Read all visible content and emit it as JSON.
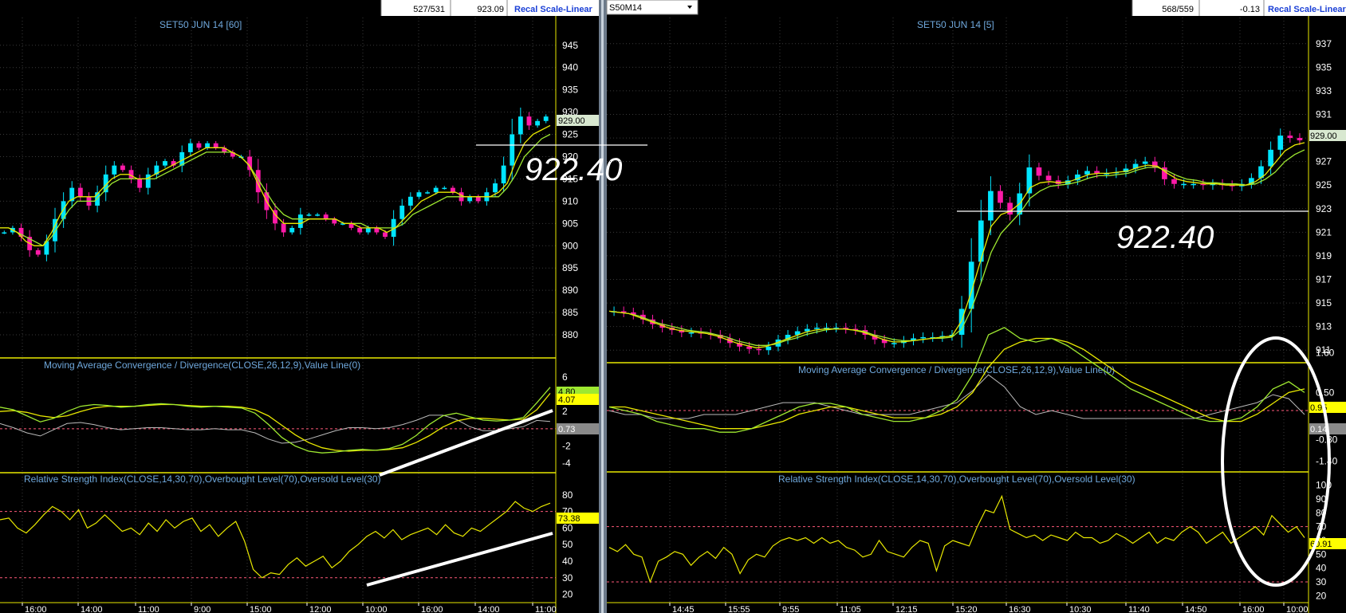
{
  "colors": {
    "background": "#000000",
    "frame": "#e8e800",
    "bull": "#00e5ff",
    "bear": "#ff1aa8",
    "ma": "#e8e800",
    "ma2": "#9ee830",
    "signal": "#bbbbbb",
    "annotation": "#ffffff",
    "grid": "#3a3a3a"
  },
  "left": {
    "header": {
      "count": "527/531",
      "price": "923.09",
      "recal": "Recal Scale-Linear"
    },
    "title": "SET50 JUN 14  [60]",
    "price_label": "929.00",
    "annotation": "922.40",
    "macd_title": "Moving Average Convergence / Divergence(CLOSE,26,12,9),Value Line(0)",
    "macd_badges": [
      "4.80",
      "4.07",
      "0.73"
    ],
    "rsi_title": "Relative Strength Index(CLOSE,14,30,70),Overbought Level(70),Oversold Level(30)",
    "rsi_badge": "73.38",
    "price_ticks": [
      "945",
      "940",
      "935",
      "930",
      "925",
      "920",
      "915",
      "910",
      "905",
      "900",
      "895",
      "890",
      "885",
      "880"
    ],
    "macd_ticks": [
      "6",
      "2",
      "-2",
      "-4"
    ],
    "rsi_ticks": [
      "80",
      "70",
      "60",
      "50",
      "40",
      "30",
      "20"
    ],
    "time_ticks": [
      "16:00",
      "14:00",
      "11:00",
      "9:00",
      "15:00",
      "12:00",
      "10:00",
      "16:00",
      "14:00",
      "11:00"
    ]
  },
  "right": {
    "header": {
      "symbol": "S50M14",
      "count": "568/559",
      "change": "-0.13",
      "recal": "Recal Scale-Linear"
    },
    "title": "SET50 JUN 14  [5]",
    "price_label": "929.00",
    "annotation": "922.40",
    "macd_title": "Moving Average Convergence / Divergence(CLOSE,26,12,9),Value Line(0)",
    "macd_badges": [
      "0.95",
      "0.14"
    ],
    "rsi_title": "Relative Strength Index(CLOSE,14,30,70),Overbought Level(70),Oversold Level(30)",
    "rsi_badge": "60.91",
    "price_ticks": [
      "937",
      "935",
      "933",
      "931",
      "929",
      "927",
      "925",
      "923",
      "921",
      "919",
      "917",
      "915",
      "913",
      "911"
    ],
    "macd_ticks": [
      "1.60",
      "0.50",
      "-0.80",
      "-1.40"
    ],
    "rsi_ticks": [
      "100",
      "90",
      "80",
      "70",
      "60",
      "50",
      "40",
      "30",
      "20"
    ],
    "time_ticks": [
      "14:45",
      "15:55",
      "9:55",
      "11:05",
      "12:15",
      "15:20",
      "16:30",
      "10:30",
      "11:40",
      "14:50",
      "16:00",
      "10:00"
    ]
  },
  "chart_data": [
    {
      "type": "candlestick",
      "title": "SET50 JUN 14  [60]",
      "ylim": [
        875,
        948
      ],
      "close": [
        903,
        904,
        902,
        899,
        898,
        901,
        906,
        910,
        913,
        911,
        909,
        912,
        916,
        918,
        917,
        915,
        913,
        916,
        918,
        919,
        918,
        921,
        923,
        922,
        923,
        922,
        921,
        920,
        920,
        917,
        912,
        908,
        905,
        903,
        904,
        907,
        907,
        907,
        906,
        905,
        905,
        904,
        903,
        904,
        903,
        902,
        906,
        909,
        911,
        912,
        912,
        913,
        913,
        912,
        910,
        911,
        910,
        912,
        914,
        918,
        925,
        929,
        927,
        928,
        929
      ],
      "ma_fast": [
        904,
        904,
        903,
        901,
        900,
        900,
        903,
        907,
        910,
        911,
        911,
        911,
        913,
        915,
        916,
        916,
        915,
        915,
        916,
        917,
        918,
        919,
        920,
        921,
        922,
        922,
        922,
        921,
        920,
        918,
        914,
        910,
        907,
        905,
        905,
        905,
        906,
        906,
        906,
        906,
        905,
        905,
        904,
        904,
        904,
        903,
        904,
        906,
        908,
        910,
        911,
        912,
        912,
        912,
        911,
        911,
        911,
        911,
        912,
        914,
        919,
        923,
        925,
        926,
        927
      ],
      "ma_slow": [
        904,
        904,
        903,
        902,
        901,
        900,
        902,
        905,
        908,
        910,
        910,
        910,
        912,
        914,
        915,
        915,
        915,
        915,
        915,
        916,
        917,
        918,
        919,
        920,
        921,
        921,
        921,
        921,
        920,
        918,
        915,
        912,
        909,
        907,
        906,
        906,
        906,
        906,
        906,
        906,
        905,
        905,
        905,
        904,
        904,
        904,
        904,
        905,
        907,
        908,
        909,
        910,
        911,
        911,
        911,
        911,
        911,
        911,
        911,
        913,
        916,
        920,
        922,
        924,
        925
      ]
    },
    {
      "type": "line",
      "title": "Moving Average Convergence / Divergence(CLOSE,26,12,9),Value Line(0)",
      "ylim": [
        -5,
        7
      ],
      "macd": [
        2.5,
        2.2,
        1.5,
        0.8,
        1.2,
        2.0,
        2.6,
        2.8,
        2.7,
        2.5,
        2.6,
        2.8,
        2.9,
        2.8,
        2.6,
        2.5,
        2.6,
        2.5,
        2.4,
        1.8,
        0.5,
        -1.0,
        -2.0,
        -2.6,
        -2.8,
        -2.7,
        -2.5,
        -2.4,
        -2.5,
        -2.3,
        -1.8,
        -0.8,
        0.5,
        1.5,
        1.8,
        1.4,
        1.0,
        0.9,
        1.0,
        1.3,
        3.0,
        4.8
      ],
      "signal": [
        2.0,
        2.1,
        1.9,
        1.5,
        1.3,
        1.5,
        2.0,
        2.4,
        2.6,
        2.6,
        2.6,
        2.7,
        2.8,
        2.8,
        2.7,
        2.6,
        2.6,
        2.6,
        2.5,
        2.2,
        1.5,
        0.4,
        -0.7,
        -1.6,
        -2.2,
        -2.5,
        -2.6,
        -2.5,
        -2.5,
        -2.4,
        -2.2,
        -1.6,
        -0.8,
        0.2,
        0.9,
        1.2,
        1.2,
        1.1,
        1.0,
        1.1,
        2.2,
        4.1
      ],
      "histogram": [
        0.5,
        0.1,
        -0.4,
        -0.7,
        -0.1,
        0.5,
        0.6,
        0.4,
        0.1,
        -0.1,
        0.0,
        0.1,
        0.1,
        0.0,
        -0.1,
        -0.1,
        0.0,
        -0.1,
        -0.1,
        -0.4,
        -1.0,
        -1.4,
        -1.3,
        -1.0,
        -0.6,
        -0.2,
        0.1,
        0.1,
        0.0,
        0.1,
        0.4,
        0.8,
        1.3,
        1.3,
        0.9,
        0.2,
        -0.2,
        -0.2,
        0.0,
        0.2,
        0.8,
        0.7
      ]
    },
    {
      "type": "line",
      "title": "Relative Strength Index(CLOSE,14,30,70),Overbought Level(70),Oversold Level(30)",
      "ylim": [
        15,
        90
      ],
      "overbought": 70,
      "oversold": 30,
      "rsi": [
        65,
        66,
        60,
        57,
        62,
        68,
        73,
        70,
        65,
        71,
        60,
        63,
        68,
        63,
        58,
        60,
        56,
        63,
        58,
        65,
        60,
        64,
        66,
        58,
        62,
        55,
        60,
        64,
        52,
        35,
        30,
        33,
        32,
        38,
        42,
        37,
        40,
        43,
        36,
        40,
        46,
        50,
        55,
        58,
        54,
        59,
        53,
        56,
        58,
        60,
        56,
        62,
        57,
        55,
        60,
        58,
        62,
        66,
        70,
        76,
        72,
        70,
        73,
        75
      ]
    },
    {
      "type": "candlestick",
      "title": "SET50 JUN 14  [5]",
      "ylim": [
        910,
        938
      ],
      "close": [
        914.3,
        914.2,
        914.0,
        913.6,
        913.2,
        912.9,
        912.7,
        912.5,
        912.5,
        912.4,
        912.3,
        912.0,
        911.6,
        911.3,
        911.1,
        911.0,
        911.3,
        911.9,
        912.3,
        912.6,
        912.8,
        912.9,
        912.9,
        912.9,
        912.8,
        912.7,
        912.3,
        911.9,
        911.6,
        911.6,
        911.8,
        912.0,
        912.1,
        912.1,
        912.2,
        912.3,
        914.5,
        918.5,
        922.0,
        924.5,
        923.5,
        922.5,
        924.3,
        926.5,
        925.8,
        925.4,
        925.1,
        925.4,
        925.9,
        926.2,
        926.0,
        926.0,
        926.1,
        926.4,
        926.8,
        927.0,
        926.5,
        925.5,
        925.1,
        925.1,
        925.1,
        925.0,
        925.1,
        925.0,
        924.9,
        925.1,
        925.6,
        926.6,
        928.0,
        929.2,
        929.0,
        928.8
      ],
      "ma_fast": [
        914.3,
        914.2,
        914.1,
        913.8,
        913.5,
        913.2,
        912.9,
        912.7,
        912.6,
        912.5,
        912.4,
        912.2,
        911.9,
        911.6,
        911.4,
        911.2,
        911.3,
        911.6,
        911.9,
        912.2,
        912.5,
        912.7,
        912.8,
        912.8,
        912.8,
        912.7,
        912.5,
        912.2,
        911.9,
        911.7,
        911.7,
        911.8,
        911.9,
        912.0,
        912.1,
        912.2,
        913.5,
        916.0,
        918.8,
        921.5,
        922.5,
        922.8,
        923.5,
        924.8,
        925.2,
        925.3,
        925.2,
        925.3,
        925.6,
        925.9,
        926.0,
        926.0,
        926.1,
        926.2,
        926.5,
        926.7,
        926.6,
        926.0,
        925.5,
        925.3,
        925.2,
        925.1,
        925.1,
        925.0,
        925.0,
        925.0,
        925.3,
        925.9,
        926.9,
        927.9,
        928.4,
        928.6
      ],
      "ma_slow": [
        914.3,
        914.2,
        914.1,
        913.9,
        913.6,
        913.3,
        913.1,
        912.9,
        912.7,
        912.6,
        912.5,
        912.3,
        912.1,
        911.8,
        911.6,
        911.4,
        911.4,
        911.5,
        911.8,
        912.0,
        912.3,
        912.5,
        912.7,
        912.8,
        912.8,
        912.7,
        912.6,
        912.3,
        912.1,
        911.9,
        911.8,
        911.8,
        911.9,
        912.0,
        912.0,
        912.1,
        912.8,
        914.5,
        916.8,
        919.3,
        920.9,
        921.8,
        922.7,
        923.9,
        924.5,
        924.9,
        925.0,
        925.1,
        925.3,
        925.6,
        925.8,
        925.8,
        925.9,
        926.0,
        926.3,
        926.5,
        926.5,
        926.2,
        925.8,
        925.5,
        925.4,
        925.2,
        925.2,
        925.1,
        925.1,
        925.0,
        925.1,
        925.5,
        926.1,
        927.0,
        927.6,
        928.0
      ]
    },
    {
      "type": "line",
      "title": "Moving Average Convergence / Divergence(CLOSE,26,12,9),Value Line(0)",
      "ylim": [
        -1.7,
        2.1
      ],
      "macd": [
        0.1,
        0.0,
        -0.1,
        -0.3,
        -0.4,
        -0.5,
        -0.5,
        -0.6,
        -0.6,
        -0.5,
        -0.3,
        -0.1,
        0.1,
        0.2,
        0.2,
        0.1,
        -0.1,
        -0.2,
        -0.3,
        -0.3,
        -0.2,
        0.0,
        0.3,
        1.0,
        2.1,
        2.3,
        2.0,
        1.9,
        2.0,
        1.8,
        1.5,
        1.2,
        0.9,
        0.6,
        0.4,
        0.2,
        0.0,
        -0.2,
        -0.3,
        -0.3,
        -0.2,
        0.1,
        0.6,
        0.8,
        0.5
      ],
      "signal": [
        0.1,
        0.1,
        0.0,
        -0.1,
        -0.2,
        -0.3,
        -0.4,
        -0.5,
        -0.5,
        -0.5,
        -0.4,
        -0.3,
        -0.1,
        0.0,
        0.1,
        0.1,
        0.0,
        -0.1,
        -0.2,
        -0.2,
        -0.2,
        -0.1,
        0.1,
        0.5,
        1.2,
        1.7,
        1.9,
        2.0,
        2.0,
        1.9,
        1.7,
        1.4,
        1.1,
        0.8,
        0.6,
        0.4,
        0.2,
        0.0,
        -0.2,
        -0.3,
        -0.3,
        -0.1,
        0.2,
        0.5,
        0.6
      ],
      "histogram": [
        0.0,
        -0.1,
        -0.1,
        -0.2,
        -0.2,
        -0.2,
        -0.1,
        -0.1,
        -0.1,
        0.0,
        0.1,
        0.2,
        0.2,
        0.2,
        0.1,
        0.0,
        -0.1,
        -0.1,
        -0.1,
        -0.1,
        0.0,
        0.1,
        0.2,
        0.5,
        0.9,
        0.6,
        0.1,
        -0.1,
        0.0,
        -0.1,
        -0.2,
        -0.2,
        -0.2,
        -0.2,
        -0.2,
        -0.2,
        -0.2,
        -0.2,
        -0.1,
        0.0,
        0.1,
        0.2,
        0.4,
        0.3,
        -0.1
      ]
    },
    {
      "type": "line",
      "title": "Relative Strength Index(CLOSE,14,30,70),Overbought Level(70),Oversold Level(30)",
      "ylim": [
        15,
        105
      ],
      "overbought": 70,
      "oversold": 30,
      "rsi": [
        55,
        52,
        57,
        50,
        48,
        30,
        45,
        48,
        52,
        50,
        42,
        48,
        52,
        47,
        55,
        50,
        36,
        46,
        50,
        48,
        56,
        60,
        62,
        60,
        62,
        58,
        62,
        58,
        60,
        55,
        53,
        48,
        50,
        60,
        52,
        50,
        48,
        55,
        60,
        58,
        38,
        56,
        60,
        58,
        56,
        70,
        82,
        80,
        92,
        68,
        65,
        62,
        64,
        60,
        64,
        62,
        60,
        66,
        62,
        62,
        58,
        60,
        65,
        62,
        58,
        62,
        66,
        58,
        62,
        60,
        66,
        70,
        66,
        58,
        62,
        66,
        58,
        62,
        66,
        70,
        64,
        78,
        72,
        66,
        70,
        62
      ]
    }
  ]
}
